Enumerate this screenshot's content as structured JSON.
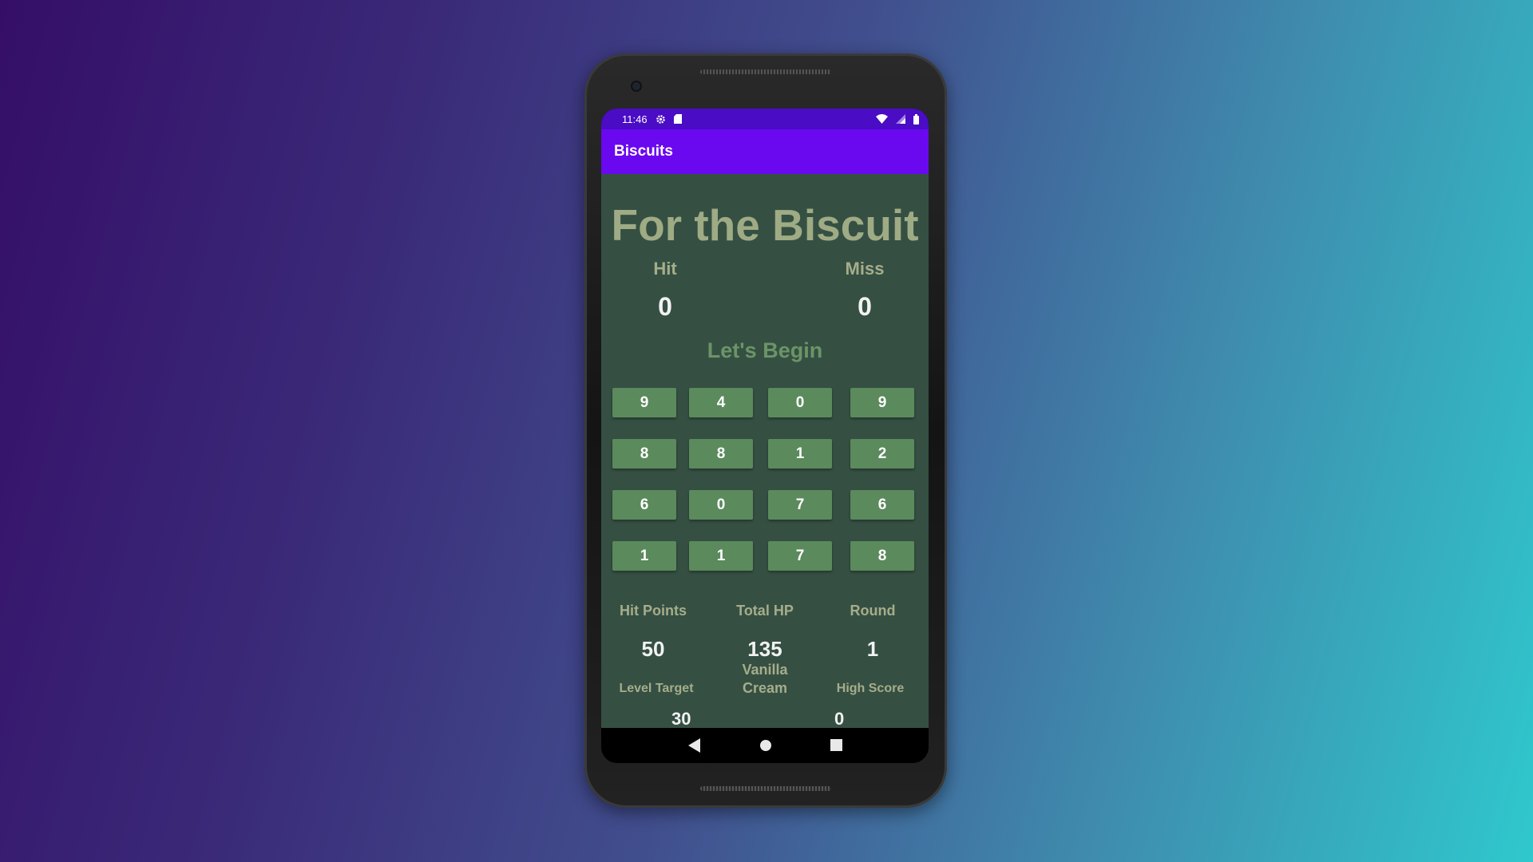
{
  "status_bar": {
    "time": "11:46",
    "icons": [
      "gear-icon",
      "sd-card-icon",
      "wifi-icon",
      "signal-icon",
      "battery-icon"
    ]
  },
  "app_bar": {
    "title": "Biscuits"
  },
  "game": {
    "title": "For the Biscuit",
    "hit_label": "Hit",
    "hit_value": "0",
    "miss_label": "Miss",
    "miss_value": "0",
    "message": "Let's Begin",
    "grid": [
      [
        "9",
        "4",
        "0",
        "9"
      ],
      [
        "8",
        "8",
        "1",
        "2"
      ],
      [
        "6",
        "0",
        "7",
        "6"
      ],
      [
        "1",
        "1",
        "7",
        "8"
      ]
    ],
    "stats": {
      "hit_points_label": "Hit Points",
      "hit_points_value": "50",
      "total_hp_label": "Total HP",
      "total_hp_value": "135",
      "round_label": "Round",
      "round_value": "1",
      "level_target_label": "Level Target",
      "level_target_value": "30",
      "biscuit_label": "Vanilla Cream",
      "high_score_label": "High Score",
      "high_score_value": "0"
    }
  },
  "nav_bar": {
    "icons": [
      "back-icon",
      "home-icon",
      "recents-icon"
    ]
  },
  "colors": {
    "background_start": "#350e68",
    "background_end": "#2fc8cd",
    "status_bar": "#4a0cc4",
    "app_bar": "#6a08f0",
    "content_bg": "#355043",
    "grid_button": "#5b8a5c",
    "title_text": "#9fab84",
    "message_text": "#6c9467"
  }
}
